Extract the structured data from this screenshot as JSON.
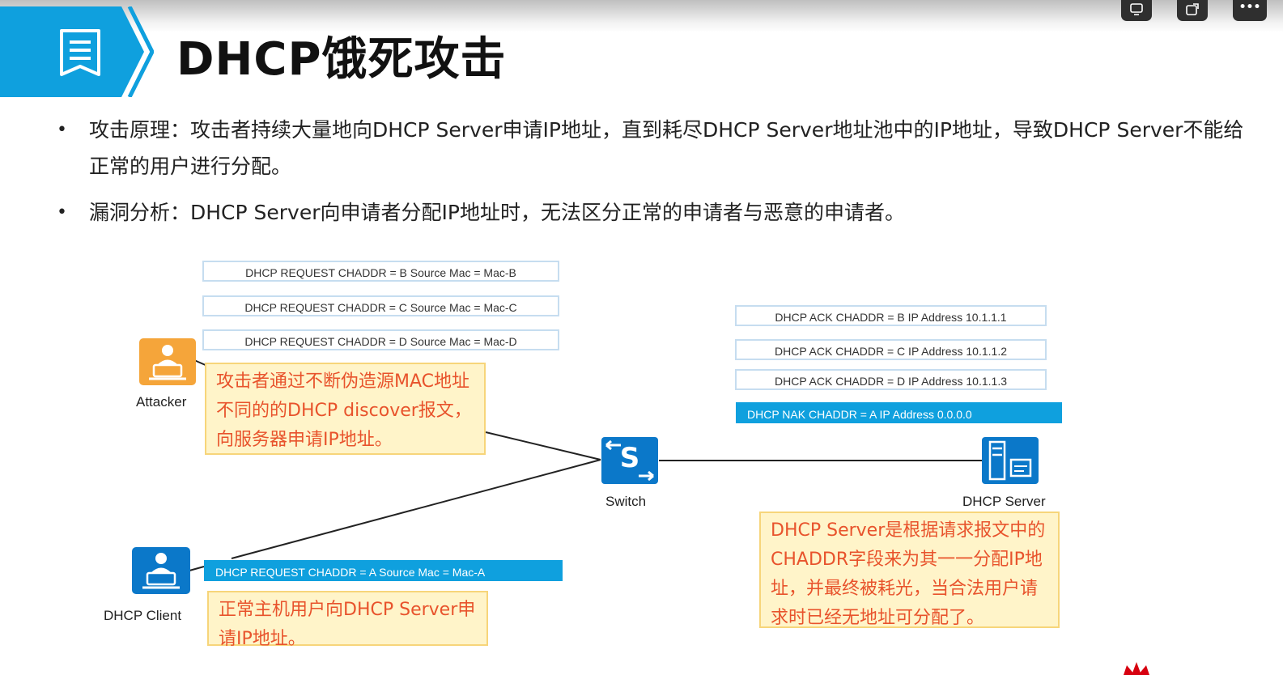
{
  "slide": {
    "title": "DHCP饿死攻击",
    "bullets": [
      "攻击原理：攻击者持续大量地向DHCP Server申请IP地址，直到耗尽DHCP Server地址池中的IP地址，导致DHCP Server不能给正常的用户进行分配。",
      "漏洞分析：DHCP Server向申请者分配IP地址时，无法区分正常的申请者与恶意的申请者。"
    ],
    "bullet_marker": "•"
  },
  "window_controls": [
    "screen-share-icon",
    "external-window-icon",
    "more-icon"
  ],
  "window_more_label": "•••",
  "diagram": {
    "devices": {
      "attacker": "Attacker",
      "switch": "Switch",
      "dhcp_server": "DHCP Server",
      "dhcp_client": "DHCP Client",
      "switch_letter": "S"
    },
    "requests": [
      "DHCP REQUEST  CHADDR = B  Source Mac = Mac-B",
      "DHCP REQUEST  CHADDR = C  Source Mac = Mac-C",
      "DHCP REQUEST  CHADDR = D  Source Mac = Mac-D"
    ],
    "acks": [
      "DHCP ACK  CHADDR = B  IP Address 10.1.1.1",
      "DHCP ACK  CHADDR = C  IP Address 10.1.1.2",
      "DHCP ACK  CHADDR = D  IP Address 10.1.1.3"
    ],
    "nak": "DHCP NAK   CHADDR = A      IP Address 0.0.0.0",
    "client_request": "DHCP REQUEST  CHADDR = A  Source Mac = Mac-A",
    "notes": {
      "attacker": "攻击者通过不断伪造源MAC地址不同的的DHCP discover报文，向服务器申请IP地址。",
      "client": "正常主机用户向DHCP Server申请IP地址。",
      "server": "DHCP Server是根据请求报文中的CHADDR字段来为其一一分配IP地址，并最终被耗光，当合法用户请求时已经无地址可分配了。"
    }
  },
  "colors": {
    "accent_blue": "#0fa0de",
    "attacker_orange": "#f5a53a",
    "note_bg": "#fff4c9",
    "note_text": "#e8532c",
    "device_blue": "#0b78c9"
  }
}
